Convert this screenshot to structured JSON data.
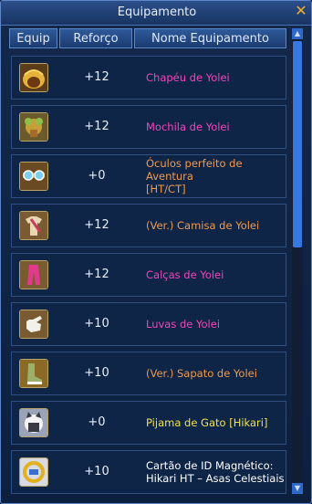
{
  "window": {
    "title": "Equipamento",
    "close_glyph": "✕"
  },
  "table": {
    "headers": [
      "Equip",
      "Reforço",
      "Nome Equipamento"
    ],
    "rows": [
      {
        "icon": "hat-icon",
        "reforco": "+12",
        "name": "Chapéu de Yolei",
        "color": "pink"
      },
      {
        "icon": "backpack-icon",
        "reforco": "+12",
        "name": "Mochila de Yolei",
        "color": "pink"
      },
      {
        "icon": "goggles-icon",
        "reforco": "+0",
        "name": "Óculos perfeito de\nAventura\n[HT/CT]",
        "color": "orange"
      },
      {
        "icon": "shirt-icon",
        "reforco": "+12",
        "name": "(Ver.) Camisa de Yolei",
        "color": "orange"
      },
      {
        "icon": "pants-icon",
        "reforco": "+12",
        "name": "Calças de Yolei",
        "color": "pink"
      },
      {
        "icon": "gloves-icon",
        "reforco": "+10",
        "name": "Luvas de Yolei",
        "color": "pink"
      },
      {
        "icon": "shoes-icon",
        "reforco": "+10",
        "name": "(Ver.) Sapato de Yolei",
        "color": "orange"
      },
      {
        "icon": "cat-pajama-icon",
        "reforco": "+0",
        "name": "Pijama de Gato [Hikari]",
        "color": "yellow"
      },
      {
        "icon": "id-card-icon",
        "reforco": "+10",
        "name": "Cartão de ID Magnético:\nHikari HT – Asas Celestiais",
        "color": "white"
      }
    ]
  },
  "colors": {
    "pink": "#f046b8",
    "orange": "#f19a4a",
    "yellow": "#f2e24a",
    "white": "#ffffff",
    "accent": "#3878e3"
  },
  "scrollbar": {
    "up": "▲",
    "down": "▼"
  }
}
